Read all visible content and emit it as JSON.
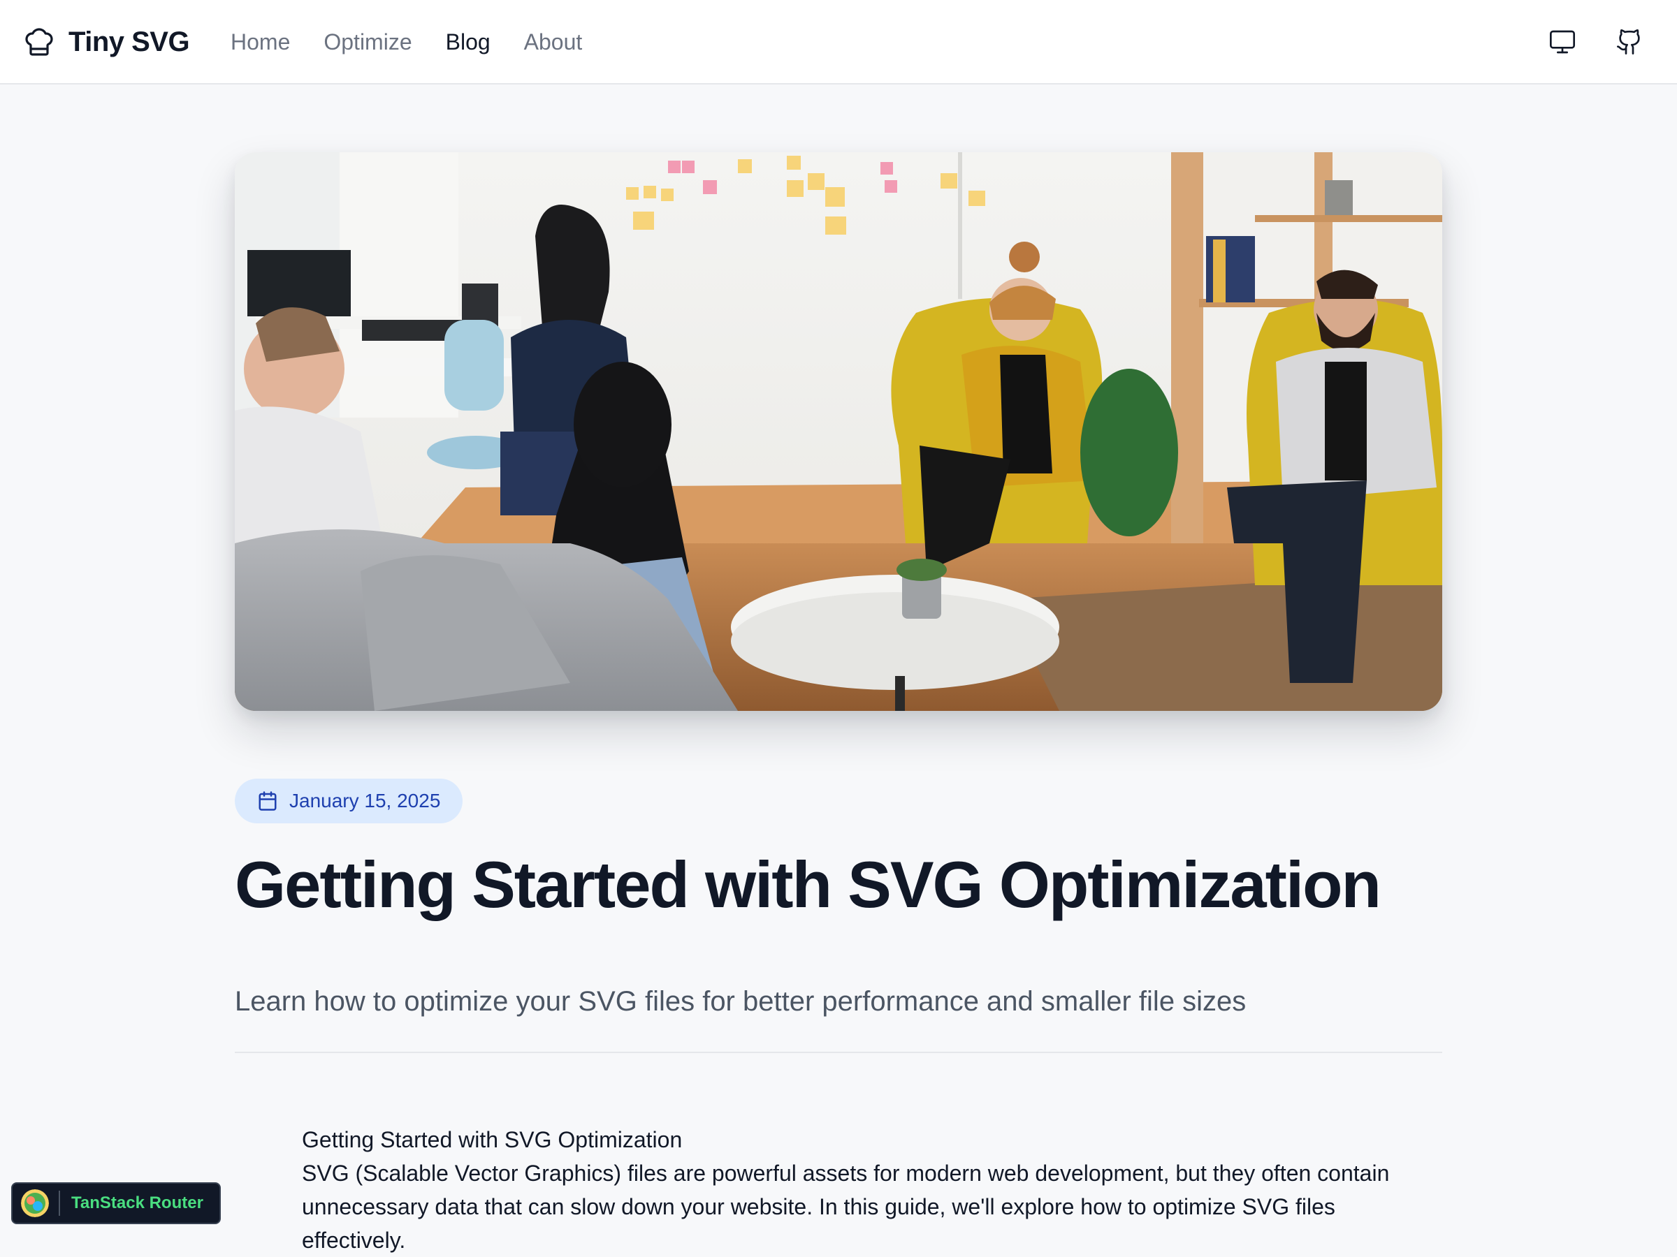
{
  "header": {
    "brand": "Tiny SVG",
    "nav": [
      "Home",
      "Optimize",
      "Blog",
      "About"
    ],
    "active_nav": "Blog",
    "icons": {
      "brand": "chef-hat-icon",
      "theme": "monitor-icon",
      "repo": "github-icon"
    }
  },
  "post": {
    "date": "January 15, 2025",
    "title": "Getting Started with SVG Optimization",
    "subtitle": "Learn how to optimize your SVG files for better performance and smaller file sizes",
    "body_heading": "Getting Started with SVG Optimization",
    "body_text": "SVG (Scalable Vector Graphics) files are powerful assets for modern web development, but they often contain unnecessary data that can slow down your website. In this guide, we'll explore how to optimize SVG files effectively."
  },
  "devtools": {
    "label": "TanStack Router"
  },
  "colors": {
    "accent": "#1e40af",
    "badge_bg": "#dbeafe",
    "text": "#111827",
    "muted": "#4b5563"
  }
}
